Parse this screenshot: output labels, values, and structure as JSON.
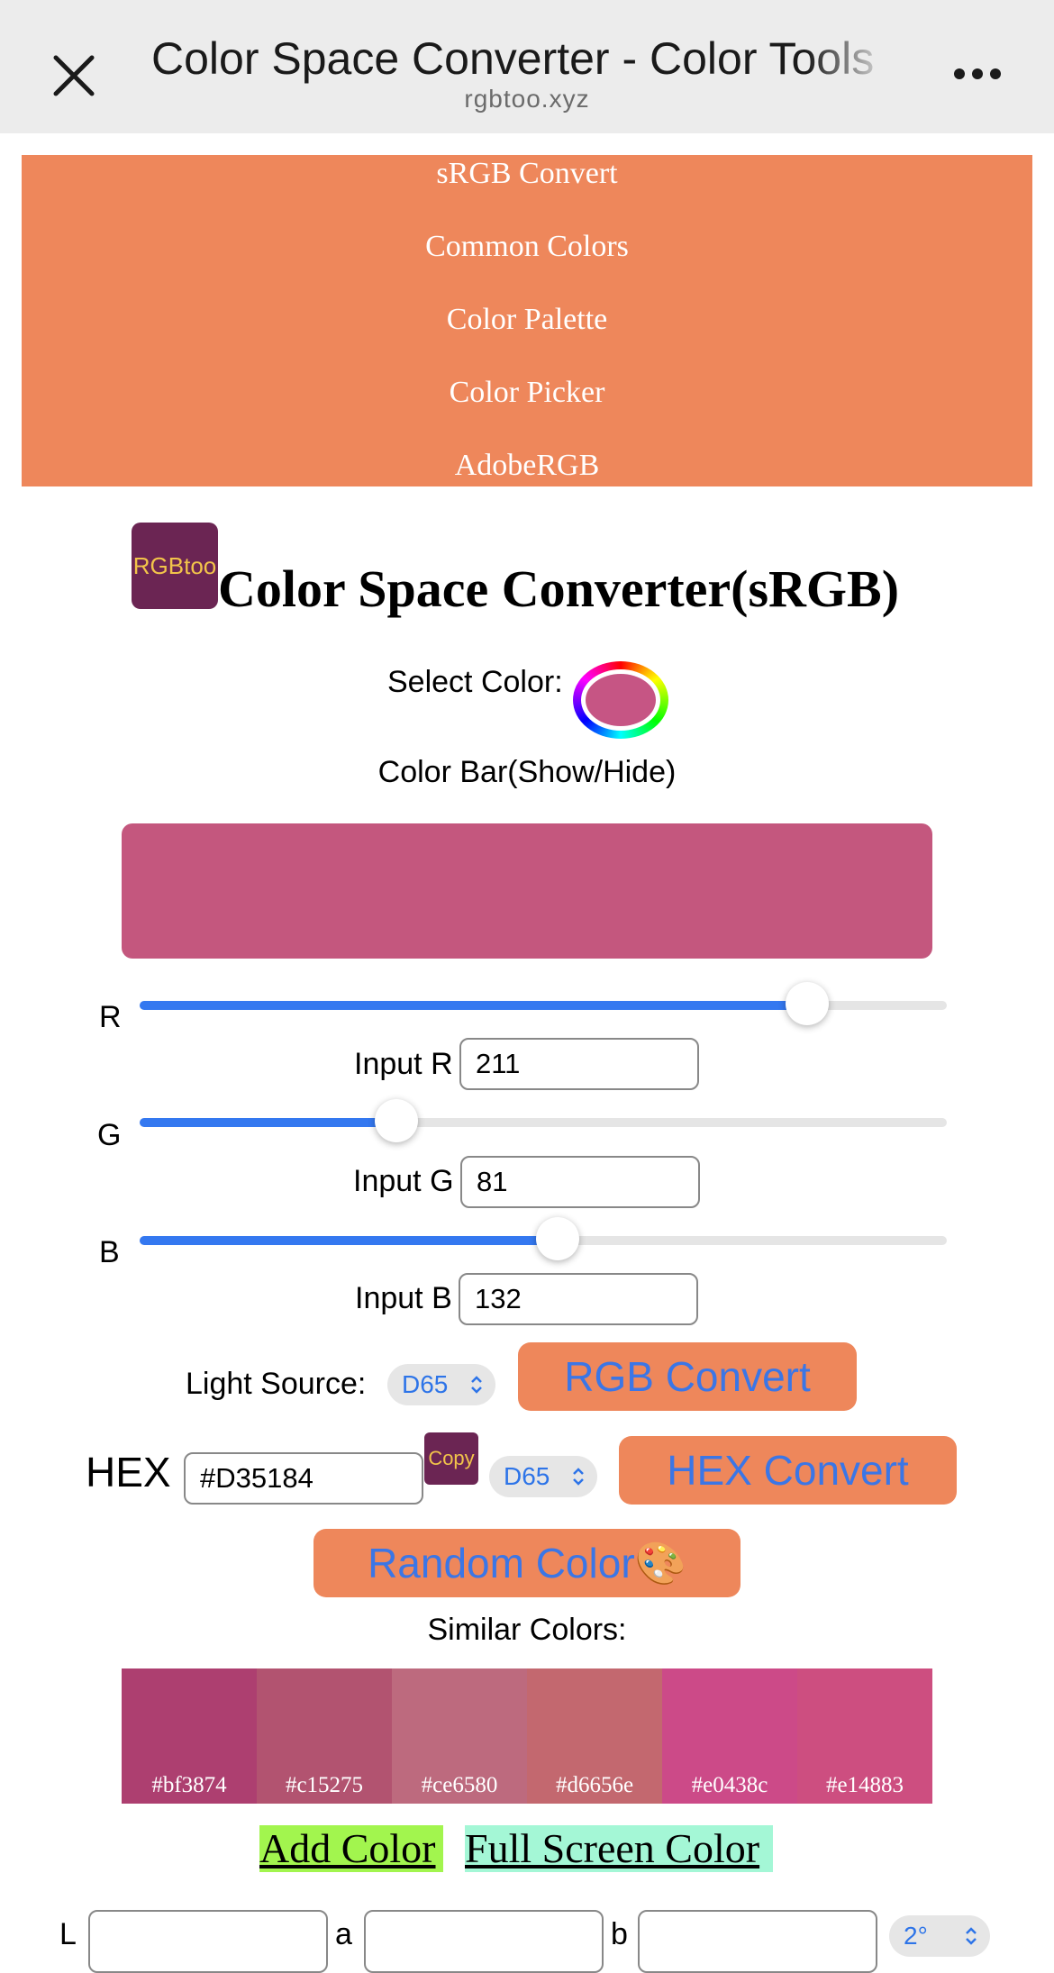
{
  "browser": {
    "title": "Color Space Converter - Color Tools",
    "url": "rgbtoo.xyz"
  },
  "nav": {
    "items": [
      "sRGB Convert",
      "Common Colors",
      "Color Palette",
      "Color Picker",
      "AdobeRGB"
    ]
  },
  "header": {
    "logo_text": "RGBtoo",
    "title": "Color Space Converter(sRGB)"
  },
  "picker": {
    "label": "Select Color:",
    "color": "#c65584"
  },
  "colorbar": {
    "toggle_label": "Color Bar(Show/Hide)",
    "color": "#c4577e"
  },
  "rgb": {
    "r": {
      "label": "R",
      "input_label": "Input R",
      "value": "211"
    },
    "g": {
      "label": "G",
      "input_label": "Input G",
      "value": "81"
    },
    "b": {
      "label": "B",
      "input_label": "Input B",
      "value": "132"
    }
  },
  "convert": {
    "light_source_label": "Light Source:",
    "light_source_value": "D65",
    "rgb_convert_label": "RGB Convert"
  },
  "hex": {
    "label": "HEX",
    "value": "#D35184",
    "copy_label": "Copy",
    "light_source_value": "D65",
    "hex_convert_label": "HEX Convert"
  },
  "random": {
    "label": "Random Color🎨"
  },
  "similar": {
    "label": "Similar Colors:",
    "colors": [
      {
        "hex": "#bf3874",
        "fill": "#ad3f70"
      },
      {
        "hex": "#c15275",
        "fill": "#b25370"
      },
      {
        "hex": "#ce6580",
        "fill": "#bd6a7e"
      },
      {
        "hex": "#d6656e",
        "fill": "#c3686f"
      },
      {
        "hex": "#e0438c",
        "fill": "#cc4a88"
      },
      {
        "hex": "#e14883",
        "fill": "#cd4e80"
      }
    ]
  },
  "links": {
    "add_color": "Add Color",
    "full_screen": "Full Screen Color"
  },
  "lab": {
    "l_label": "L",
    "a_label": "a",
    "b_label": "b",
    "observer_value": "2°"
  },
  "colors": {
    "accent": "#ee875b",
    "logo_bg": "#6b2553",
    "logo_text": "#f2c44a",
    "slider_fill": "#3478f0",
    "button_text": "#3b76e6",
    "add_color_bg": "#a2f54e",
    "full_screen_bg": "#a4f7d6"
  }
}
